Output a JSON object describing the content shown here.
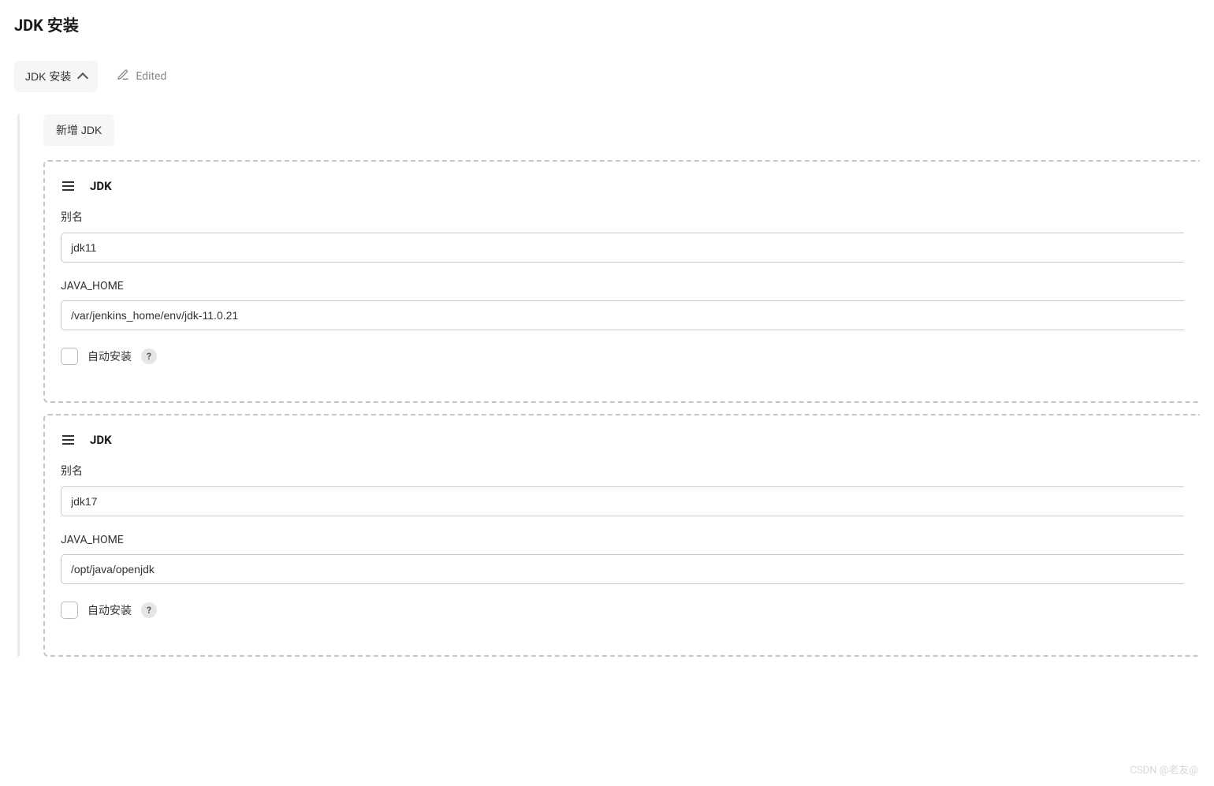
{
  "page": {
    "title": "JDK 安装"
  },
  "section": {
    "toggle_label": "JDK 安装",
    "edited_label": "Edited"
  },
  "actions": {
    "add_jdk_label": "新增 JDK"
  },
  "labels": {
    "jdk_heading": "JDK",
    "alias": "别名",
    "java_home": "JAVA_HOME",
    "auto_install": "自动安装",
    "help": "?"
  },
  "jdks": [
    {
      "alias": "jdk11",
      "java_home": "/var/jenkins_home/env/jdk-11.0.21",
      "auto_install": false
    },
    {
      "alias": "jdk17",
      "java_home": "/opt/java/openjdk",
      "auto_install": false
    }
  ],
  "watermark": "CSDN @老友@"
}
